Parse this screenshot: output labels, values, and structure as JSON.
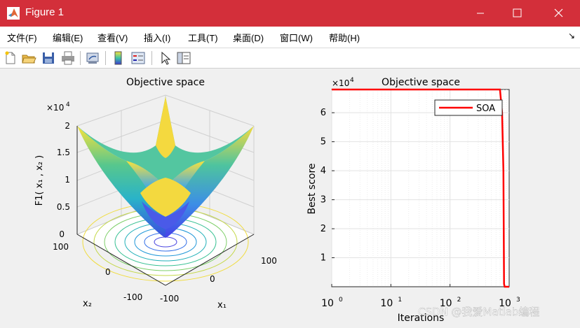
{
  "window": {
    "title": "Figure 1",
    "minimize": "—",
    "maximize": "☐",
    "close": "✕"
  },
  "menu": [
    {
      "label": "文件(F)"
    },
    {
      "label": "编辑(E)"
    },
    {
      "label": "查看(V)"
    },
    {
      "label": "插入(I)"
    },
    {
      "label": "工具(T)"
    },
    {
      "label": "桌面(D)"
    },
    {
      "label": "窗口(W)"
    },
    {
      "label": "帮助(H)"
    }
  ],
  "toolbar": {
    "icons": [
      "new-figure-icon",
      "open-file-icon",
      "save-icon",
      "print-icon",
      "link-plot-icon",
      "colorbar-icon",
      "legend-icon",
      "pointer-icon",
      "property-editor-icon"
    ],
    "dock_arrow": "↘"
  },
  "watermark": "CSDN @我爱Matlab编程",
  "left_plot": {
    "title": "Objective space",
    "zlabel": "F1( x₁ , x₂ )",
    "xlabel": "x₁",
    "ylabel": "x₂",
    "exponent_base": "×10",
    "exponent_power": "4",
    "zticks": [
      "0",
      "0.5",
      "1",
      "1.5",
      "2"
    ],
    "x1_ticks": [
      "-100",
      "0",
      "100"
    ],
    "x2_ticks": [
      "100",
      "0",
      "-100"
    ]
  },
  "chart_data": {
    "type": "line",
    "title": "Objective space",
    "xlabel": "Iterations",
    "ylabel": "Best score",
    "xscale": "log",
    "xlim": [
      1,
      1000
    ],
    "ylim": [
      0,
      68000
    ],
    "y_exponent_base": "×10",
    "y_exponent_power": "4",
    "xticks": [
      {
        "base": "10",
        "exp": "0"
      },
      {
        "base": "10",
        "exp": "1"
      },
      {
        "base": "10",
        "exp": "2"
      },
      {
        "base": "10",
        "exp": "3"
      }
    ],
    "yticks": [
      "1",
      "2",
      "3",
      "4",
      "5",
      "6"
    ],
    "grid": true,
    "legend_position": "top-right",
    "series": [
      {
        "name": "SOA",
        "color": "#ff0000",
        "x": [
          1,
          700,
          760,
          800,
          820,
          840,
          1000
        ],
        "y": [
          68000,
          68000,
          60000,
          40000,
          1000,
          0,
          0
        ]
      }
    ]
  }
}
